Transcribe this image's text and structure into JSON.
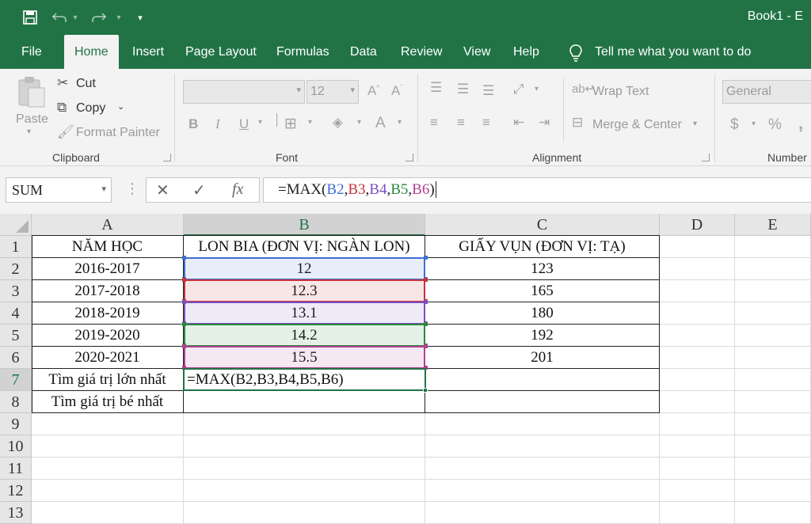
{
  "title_bar": {
    "document_title": "Book1 - E",
    "quick_access": [
      {
        "name": "save-icon",
        "glyph": "💾"
      },
      {
        "name": "undo-icon",
        "glyph": "↶"
      },
      {
        "name": "redo-icon",
        "glyph": "↷"
      },
      {
        "name": "customize-icon",
        "glyph": "▾"
      }
    ]
  },
  "ribbon_tabs": [
    {
      "label": "File"
    },
    {
      "label": "Home",
      "active": true
    },
    {
      "label": "Insert"
    },
    {
      "label": "Page Layout"
    },
    {
      "label": "Formulas"
    },
    {
      "label": "Data"
    },
    {
      "label": "Review"
    },
    {
      "label": "View"
    },
    {
      "label": "Help"
    }
  ],
  "tell_me": "Tell me what you want to do",
  "clipboard": {
    "paste": "Paste",
    "cut": "Cut",
    "copy": "Copy",
    "format_painter": "Format Painter",
    "label": "Clipboard"
  },
  "font": {
    "font_name": "",
    "font_size": "12",
    "bold": "B",
    "italic": "I",
    "underline": "U",
    "label": "Font"
  },
  "alignment": {
    "wrap_text": "Wrap Text",
    "merge_center": "Merge & Center",
    "label": "Alignment"
  },
  "number": {
    "format": "General",
    "currency": "$",
    "percent": "%",
    "comma": ",",
    "label": "Number"
  },
  "formula_bar": {
    "name_box": "SUM",
    "fx": "fx",
    "formula_parts": [
      {
        "text": "=MAX(",
        "color": "#222222"
      },
      {
        "text": "B2",
        "color": "#3f6fd1"
      },
      {
        "text": ",",
        "color": "#222222"
      },
      {
        "text": "B3",
        "color": "#c8343c"
      },
      {
        "text": ",",
        "color": "#222222"
      },
      {
        "text": "B4",
        "color": "#7a4fc0"
      },
      {
        "text": ",",
        "color": "#222222"
      },
      {
        "text": "B5",
        "color": "#2a8a3a"
      },
      {
        "text": ",",
        "color": "#222222"
      },
      {
        "text": "B6",
        "color": "#b0418f"
      },
      {
        "text": ")",
        "color": "#222222"
      }
    ]
  },
  "columns": [
    "A",
    "B",
    "C",
    "D",
    "E"
  ],
  "rows": [
    "1",
    "2",
    "3",
    "4",
    "5",
    "6",
    "7",
    "8",
    "9",
    "10",
    "11",
    "12",
    "13"
  ],
  "cells": {
    "A": [
      "NĂM HỌC",
      "2016-2017",
      "2017-2018",
      "2018-2019",
      "2019-2020",
      "2020-2021",
      "Tìm giá trị lớn nhất",
      "Tìm giá trị bé nhất"
    ],
    "B": [
      "LON BIA (ĐƠN VỊ: NGÀN LON)",
      "12",
      "12.3",
      "13.1",
      "14.2",
      "15.5",
      "=MAX(B2,B3,B4,B5,B6)",
      ""
    ],
    "C": [
      "GIẤY VỤN (ĐƠN VỊ: TẠ)",
      "123",
      "165",
      "180",
      "192",
      "201",
      "",
      ""
    ]
  },
  "colors": {
    "accent": "#217346",
    "ref_b2": "#3f6fd1",
    "ref_b3": "#c8343c",
    "ref_b4": "#7a4fc0",
    "ref_b5": "#2a8a3a",
    "ref_b6": "#b0418f"
  }
}
